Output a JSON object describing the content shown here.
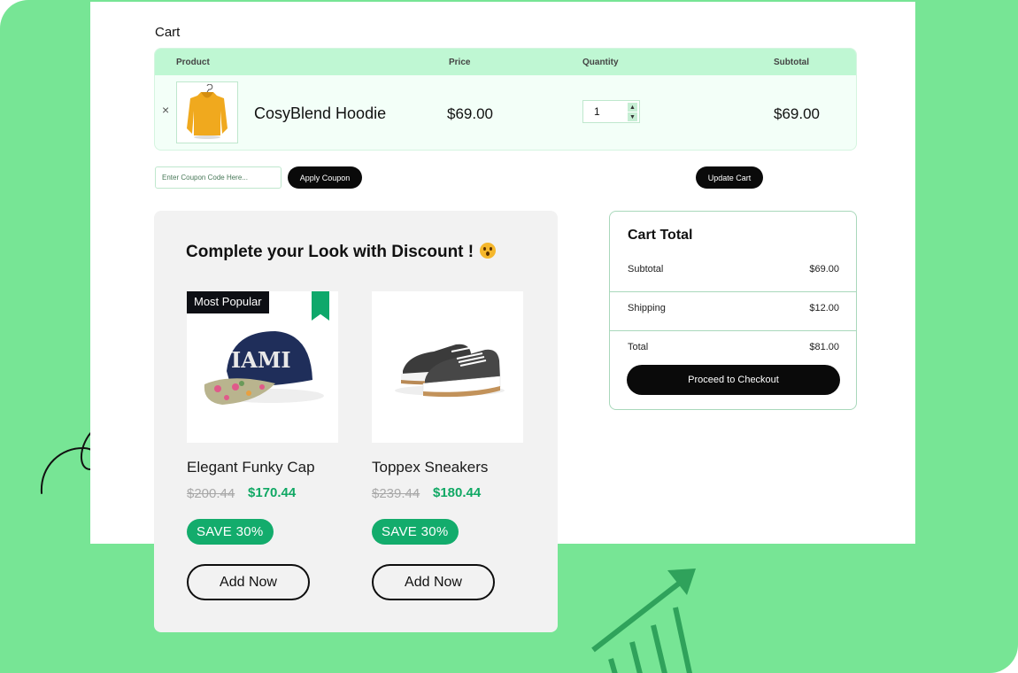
{
  "colors": {
    "background_green": "#77e595",
    "header_mint": "#bff7d3",
    "accent_green": "#13ac6c",
    "button_black": "#0a0a0a"
  },
  "cart": {
    "title": "Cart",
    "columns": [
      "Product",
      "Price",
      "Quantity",
      "Subtotal"
    ],
    "items": [
      {
        "remove_icon": "×",
        "image": "yellow-hoodie",
        "name": "CosyBlend Hoodie",
        "price": "$69.00",
        "quantity": "1",
        "subtotal": "$69.00"
      }
    ]
  },
  "coupon": {
    "placeholder": "Enter Coupon Code Here...",
    "apply_label": "Apply Coupon"
  },
  "update_cart_label": "Update Cart",
  "upsell": {
    "title": "Complete your Look with Discount !",
    "emoji": "surprised-face-icon",
    "products": [
      {
        "badge": "Most Popular",
        "bookmark": true,
        "image": "snapback-cap",
        "name": "Elegant Funky Cap",
        "old_price": "$200.44",
        "new_price": "$170.44",
        "save": "SAVE 30%",
        "cta": "Add Now"
      },
      {
        "image": "sneakers",
        "name": "Toppex Sneakers",
        "old_price": "$239.44",
        "new_price": "$180.44",
        "save": "SAVE 30%",
        "cta": "Add Now"
      }
    ]
  },
  "cart_total": {
    "title": "Cart Total",
    "rows": [
      {
        "label": "Subtotal",
        "value": "$69.00"
      },
      {
        "label": "Shipping",
        "value": "$12.00"
      },
      {
        "label": "Total",
        "value": "$81.00"
      }
    ],
    "checkout_label": "Proceed to Checkout"
  }
}
